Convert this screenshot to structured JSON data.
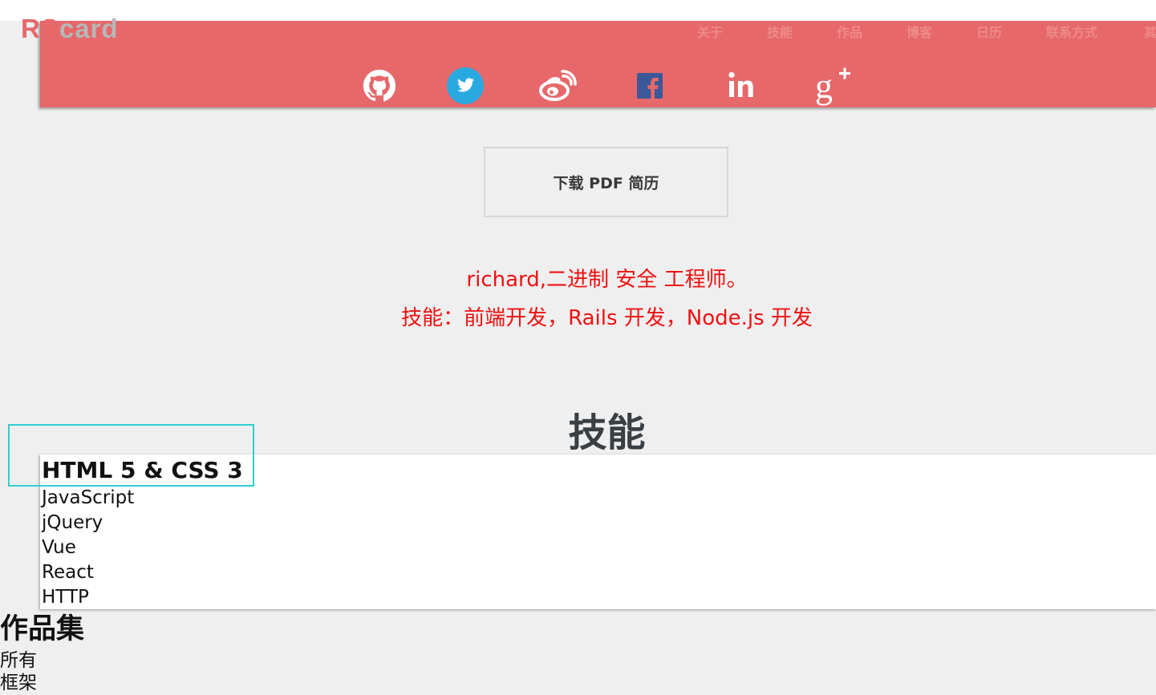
{
  "logo": {
    "part1": "RS",
    "part2": "card"
  },
  "nav": {
    "items": [
      "关于",
      "技能",
      "作品",
      "博客",
      "日历",
      "联系方式",
      "其"
    ]
  },
  "social": {
    "icons": [
      "github-icon",
      "twitter-icon",
      "weibo-icon",
      "facebook-icon",
      "linkedin-icon",
      "google-plus-icon"
    ]
  },
  "download": {
    "label": "下载 PDF 简历"
  },
  "intro": {
    "line1": "richard,二进制 安全 工程师。",
    "line2": "技能：前端开发，Rails 开发，Node.js 开发"
  },
  "skills": {
    "title": "技能",
    "items": [
      "HTML 5 & CSS 3",
      "JavaScript",
      "jQuery",
      "Vue",
      "React",
      "HTTP"
    ]
  },
  "portfolio": {
    "title": "作品集",
    "filters": [
      "所有",
      "框架"
    ]
  },
  "colors": {
    "banner": "#e6686a",
    "nav_text": "#ee8a8b",
    "intro_text": "#f01010",
    "highlight": "#2ecfd1",
    "twitter": "#29a9e0",
    "facebook": "#3b5998"
  }
}
